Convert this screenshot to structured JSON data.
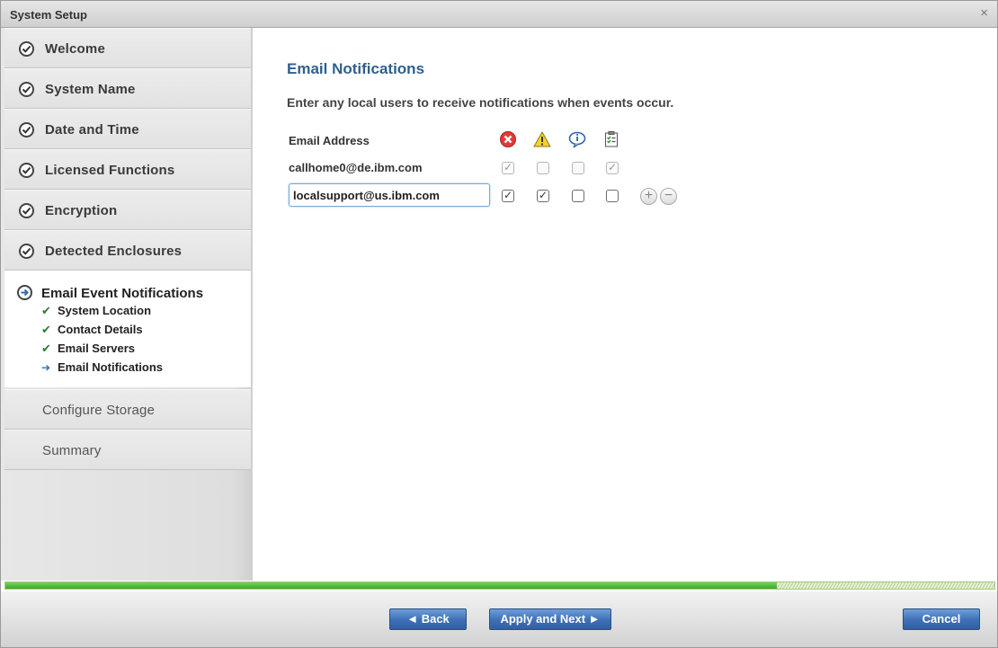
{
  "window": {
    "title": "System Setup",
    "close_glyph": "×"
  },
  "sidebar": {
    "steps": [
      {
        "label": "Welcome",
        "icon": "check-circle-icon"
      },
      {
        "label": "System Name",
        "icon": "check-circle-icon"
      },
      {
        "label": "Date and Time",
        "icon": "check-circle-icon"
      },
      {
        "label": "Licensed Functions",
        "icon": "check-circle-icon"
      },
      {
        "label": "Encryption",
        "icon": "check-circle-icon"
      },
      {
        "label": "Detected Enclosures",
        "icon": "check-circle-icon"
      }
    ],
    "active": {
      "label": "Email Event Notifications",
      "icon": "arrow-circle-icon",
      "substeps": [
        {
          "label": "System Location",
          "state": "done"
        },
        {
          "label": "Contact Details",
          "state": "done"
        },
        {
          "label": "Email Servers",
          "state": "done"
        },
        {
          "label": "Email Notifications",
          "state": "current"
        }
      ]
    },
    "pending": [
      {
        "label": "Configure Storage"
      },
      {
        "label": "Summary"
      }
    ]
  },
  "main": {
    "heading": "Email Notifications",
    "description": "Enter any local users to receive notifications when events occur.",
    "column_header": "Email Address",
    "event_icons": [
      "error-icon",
      "warning-icon",
      "info-icon",
      "inventory-icon"
    ],
    "rows": [
      {
        "email": "callhome0@de.ibm.com",
        "error": true,
        "warning": false,
        "info": false,
        "inventory": true,
        "editable": false
      },
      {
        "email": "localsupport@us.ibm.com",
        "error": true,
        "warning": true,
        "info": false,
        "inventory": false,
        "editable": true
      }
    ]
  },
  "progress": {
    "fraction": 0.78
  },
  "footer": {
    "back_label": "◄ Back",
    "next_label": "Apply and Next ►",
    "cancel_label": "Cancel"
  },
  "colors": {
    "heading": "#2f5f8f",
    "button": "#3e6fb5",
    "progress": "#3aa929"
  }
}
